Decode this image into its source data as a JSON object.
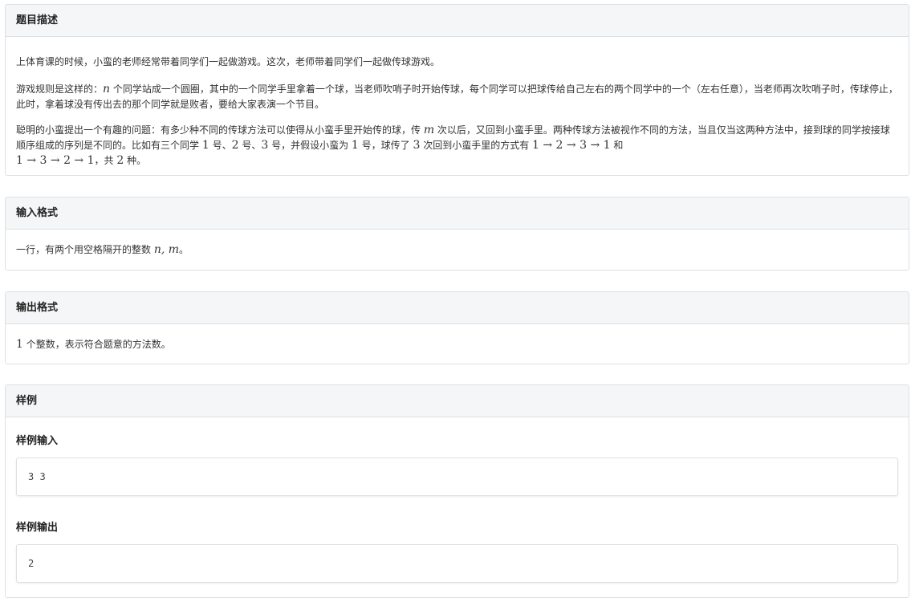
{
  "description": {
    "header": "题目描述",
    "p1": "上体育课的时候，小蛮的老师经常带着同学们一起做游戏。这次，老师带着同学们一起做传球游戏。",
    "p2": {
      "a": "游戏规则是这样的：",
      "n": "n",
      "b": " 个同学站成一个圆圈，其中的一个同学手里拿着一个球，当老师吹哨子时开始传球，每个同学可以把球传给自己左右的两个同学中的一个（左右任意），当老师再次吹哨子时，传球停止，此时，拿着球没有传出去的那个同学就是败者，要给大家表演一个节目。"
    },
    "p3": {
      "a": "聪明的小蛮提出一个有趣的问题：有多少种不同的传球方法可以使得从小蛮手里开始传的球，传 ",
      "m": "m",
      "b": " 次以后，又回到小蛮手里。两种传球方法被视作不同的方法，当且仅当这两种方法中，接到球的同学按接球顺序组成的序列是不同的。比如有三个同学 ",
      "one": "1",
      "c": " 号、",
      "two": "2",
      "d": " 号、",
      "three": "3",
      "e": " 号，并假设小蛮为 ",
      "one2": "1",
      "f": " 号，球传了 ",
      "three2": "3",
      "g": " 次回到小蛮手里的方式有 ",
      "seq1": "1 → 2 → 3 → 1",
      "h": " 和",
      "seq2": "1 → 3 → 2 → 1",
      "i": "，共 ",
      "two2": "2",
      "j": " 种。"
    }
  },
  "input_format": {
    "header": "输入格式",
    "text_a": "一行，有两个用空格隔开的整数 ",
    "vars": "n, m",
    "text_b": "。"
  },
  "output_format": {
    "header": "输出格式",
    "one": "1",
    "text": " 个整数，表示符合题意的方法数。"
  },
  "samples": {
    "header": "样例",
    "input_title": "样例输入",
    "input_value": "3 3",
    "output_title": "样例输出",
    "output_value": "2"
  }
}
